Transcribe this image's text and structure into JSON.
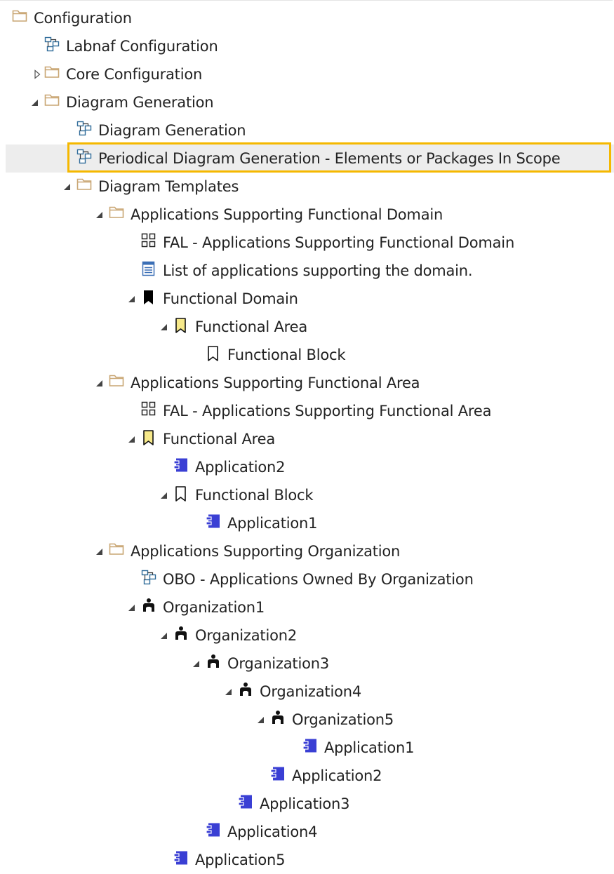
{
  "tree": {
    "items": [
      {
        "label": "Configuration",
        "icon": "folder-icon",
        "level": 0,
        "expander": "none"
      },
      {
        "label": "Labnaf Configuration",
        "icon": "diagram-icon",
        "level": 1,
        "expander": "none"
      },
      {
        "label": "Core Configuration",
        "icon": "folder-icon",
        "level": 1,
        "expander": "collapsed"
      },
      {
        "label": "Diagram Generation",
        "icon": "folder-icon",
        "level": 1,
        "expander": "expanded"
      },
      {
        "label": "Diagram Generation",
        "icon": "diagram-icon",
        "level": 2,
        "expander": "none"
      },
      {
        "label": "Periodical Diagram Generation - Elements or Packages In Scope",
        "icon": "diagram-icon",
        "level": 2,
        "expander": "none",
        "selected": true
      },
      {
        "label": "Diagram Templates",
        "icon": "folder-icon",
        "level": 2,
        "expander": "expanded"
      },
      {
        "label": "Applications Supporting Functional Domain",
        "icon": "folder-icon",
        "level": 3,
        "expander": "expanded"
      },
      {
        "label": "FAL - Applications Supporting Functional Domain",
        "icon": "grid-diagram-icon",
        "level": 4,
        "expander": "none"
      },
      {
        "label": "List of applications supporting the domain.",
        "icon": "list-icon",
        "level": 4,
        "expander": "none"
      },
      {
        "label": "Functional Domain",
        "icon": "bookmark-black-icon",
        "level": 4,
        "expander": "expanded"
      },
      {
        "label": "Functional Area",
        "icon": "bookmark-yellow-icon",
        "level": 5,
        "expander": "expanded"
      },
      {
        "label": "Functional Block",
        "icon": "bookmark-outline-icon",
        "level": 6,
        "expander": "none"
      },
      {
        "label": "Applications Supporting Functional Area",
        "icon": "folder-icon",
        "level": 3,
        "expander": "expanded"
      },
      {
        "label": "FAL - Applications Supporting Functional Area",
        "icon": "grid-diagram-icon",
        "level": 4,
        "expander": "none"
      },
      {
        "label": "Functional Area",
        "icon": "bookmark-yellow-icon",
        "level": 4,
        "expander": "expanded"
      },
      {
        "label": "Application2",
        "icon": "application-icon",
        "level": 5,
        "expander": "none"
      },
      {
        "label": "Functional Block",
        "icon": "bookmark-outline-icon",
        "level": 5,
        "expander": "expanded"
      },
      {
        "label": "Application1",
        "icon": "application-icon",
        "level": 6,
        "expander": "none"
      },
      {
        "label": "Applications Supporting Organization",
        "icon": "folder-icon",
        "level": 3,
        "expander": "expanded"
      },
      {
        "label": "OBO - Applications Owned By Organization",
        "icon": "diagram-icon",
        "level": 4,
        "expander": "none"
      },
      {
        "label": "Organization1",
        "icon": "organization-icon",
        "level": 4,
        "expander": "expanded"
      },
      {
        "label": "Organization2",
        "icon": "organization-icon",
        "level": 5,
        "expander": "expanded"
      },
      {
        "label": "Organization3",
        "icon": "organization-icon",
        "level": 6,
        "expander": "expanded"
      },
      {
        "label": "Organization4",
        "icon": "organization-icon",
        "level": 7,
        "expander": "expanded"
      },
      {
        "label": "Organization5",
        "icon": "organization-icon",
        "level": 8,
        "expander": "expanded"
      },
      {
        "label": "Application1",
        "icon": "application-icon",
        "level": 9,
        "expander": "none"
      },
      {
        "label": "Application2",
        "icon": "application-icon",
        "level": 8,
        "expander": "none"
      },
      {
        "label": "Application3",
        "icon": "application-icon",
        "level": 7,
        "expander": "none"
      },
      {
        "label": "Application4",
        "icon": "application-icon",
        "level": 6,
        "expander": "none"
      },
      {
        "label": "Application5",
        "icon": "application-icon",
        "level": 5,
        "expander": "none"
      }
    ]
  },
  "colors": {
    "folder": "#c9a673",
    "diagram": "#2f6b9a",
    "application": "#3a3fd4",
    "bookmark_yellow": "#f7e98a",
    "selection_border": "#f5b800",
    "selection_bg": "#ededed"
  }
}
